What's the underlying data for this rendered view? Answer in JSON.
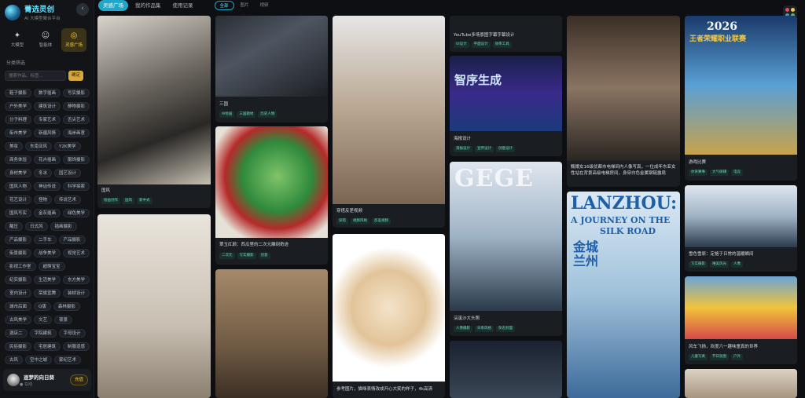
{
  "brand": {
    "name": "菁选灵创",
    "subtitle": "AI 大模型聚合平台",
    "collapse_icon": "‹"
  },
  "nav": [
    {
      "label": "大模型",
      "icon": "sparkle-icon"
    },
    {
      "label": "智能体",
      "icon": "person-icon"
    },
    {
      "label": "灵感广场",
      "icon": "bulb-icon"
    }
  ],
  "filter": {
    "section_label": "分类筛选",
    "placeholder": "搜索作品、标签...",
    "button": "确定"
  },
  "tags": [
    "鞋子摄影",
    "数字插画",
    "写实摄影",
    "户外美学",
    "建筑设计",
    "静物摄影",
    "分子料理",
    "专家艺术",
    "舌尖艺术",
    "街市美学",
    "新疆风情",
    "海岸画意",
    "美妆",
    "东南亚风",
    "Y2K美学",
    "商务体验",
    "花卉插画",
    "服饰摄影",
    "身材美学",
    "冬冰",
    "园艺设计",
    "国风人物",
    "神话传说",
    "科学探索",
    "花艺设计",
    "怪物",
    "传说艺术",
    "国风写实",
    "金灰插画",
    "绿色美学",
    "醒压",
    "日式风",
    "插画摄影",
    "产品摄影",
    "二手车",
    "产品摄影",
    "街景摄影",
    "战争美学",
    "视觉艺术",
    "影视工作室",
    "超萌宝宝",
    "纪实摄影",
    "生活美学",
    "东方美学",
    "室内设计",
    "荣旗宣腾",
    "",
    "",
    "装帧设计",
    "城市后面",
    "Q版",
    "森林摄影",
    "古风美学",
    "文艺",
    "夜景",
    "酒店二",
    "字院建筑",
    "字母设计",
    "民俗摄影",
    "宅居建筑",
    "制服道感",
    "古风",
    "空中之城",
    "家纪艺术",
    "寻美生活",
    "素描高清"
  ],
  "user": {
    "name": "逐梦的向日葵",
    "status": "● 在线",
    "vip": "充值"
  },
  "top_tabs": [
    "灵感广场",
    "我的作品集",
    "使用记录"
  ],
  "filter_tabs": [
    "全部",
    "图片",
    "视频"
  ],
  "cards": [
    {
      "caption": "国风",
      "chips": [
        "绘画创作",
        "国风",
        "新中式"
      ]
    },
    {
      "caption": "",
      "chips": []
    },
    {
      "caption": "三国",
      "chips": [
        "AI绘画",
        "三国题材",
        "历史人物"
      ]
    },
    {
      "caption": "翠玉红颜：西瓜里的二次元雕刻奇迹",
      "chips": [
        "二次元",
        "写实摄影",
        "创意",
        "创意设计"
      ]
    },
    {
      "caption": "",
      "chips": []
    },
    {
      "caption": "穿搭反差视频",
      "chips": [
        "穿搭",
        "视频风格",
        "反差视频"
      ]
    },
    {
      "caption": "参考图片，猫咪表情改成开心大笑的样子，4k高清",
      "chips": []
    },
    {
      "caption": "YouTube多场景图字幕字幕设计",
      "chips": [
        "UI设计",
        "平面设计",
        "效率工具"
      ]
    },
    {
      "caption": "海报设计",
      "chips": [
        "海报设计",
        "宣传设计",
        "创意设计"
      ]
    },
    {
      "caption": "浣溪沙大头照",
      "chips": [
        "人像摄影",
        "日系风格",
        "杂志封面"
      ]
    },
    {
      "caption": "",
      "chips": []
    },
    {
      "caption": "甄嬛女16级优都市电梯间内人像写真，一位成年东亚女性站在背景高级电梯房间，身穿白色金属钢链露肩装……",
      "chips": [
        "写实摄影",
        "都市写真",
        "人物"
      ]
    },
    {
      "caption": "",
      "chips": []
    },
    {
      "caption": "游戏比赛",
      "chips": [
        "体育赛事",
        "大气磅礴",
        "电竞"
      ]
    },
    {
      "caption": "雪色雪原：定格于日常的温暖瞬间",
      "chips": [
        "写实摄影",
        "唯美风光",
        "人像"
      ]
    },
    {
      "caption": "风车飞扬，欢度六一趣味童真的世界",
      "chips": [
        "儿童写真",
        "节日氛围",
        "户外"
      ]
    },
    {
      "caption": "",
      "chips": []
    }
  ],
  "posters": {
    "app_title": "智序生成",
    "magazine": "GEGE",
    "lanzhou_title": "LANZHOU:",
    "lanzhou_sub1": "A JOURNEY ON THE",
    "lanzhou_sub2": "SILK ROAD",
    "lanzhou_cn": "金城兰州",
    "esports_year": "2026",
    "esports_title": "王者荣耀职业联赛"
  },
  "colors": {
    "accent": "#1fa6c8",
    "gold": "#f2c94c",
    "chip": "#6fd3c2"
  }
}
